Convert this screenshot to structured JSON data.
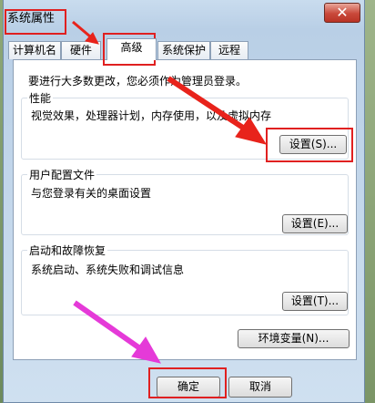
{
  "window": {
    "title": "系统属性",
    "close_symbol": "✕"
  },
  "tabs": [
    {
      "label": "计算机名"
    },
    {
      "label": "硬件"
    },
    {
      "label": "高级",
      "active": true
    },
    {
      "label": "系统保护"
    },
    {
      "label": "远程"
    }
  ],
  "notice": "要进行大多数更改，您必须作为管理员登录。",
  "performance": {
    "title": "性能",
    "description": "视觉效果，处理器计划，内存使用，以及虚拟内存",
    "button": "设置(S)..."
  },
  "user_profiles": {
    "title": "用户配置文件",
    "description": "与您登录有关的桌面设置",
    "button": "设置(E)..."
  },
  "startup_recovery": {
    "title": "启动和故障恢复",
    "description": "系统启动、系统失败和调试信息",
    "button": "设置(T)..."
  },
  "env_button": "环境变量(N)...",
  "footer": {
    "ok": "确定",
    "cancel": "取消"
  },
  "colors": {
    "highlight": "#e02020",
    "arrow_red": "#e8231b",
    "arrow_magenta": "#e53ad8"
  }
}
